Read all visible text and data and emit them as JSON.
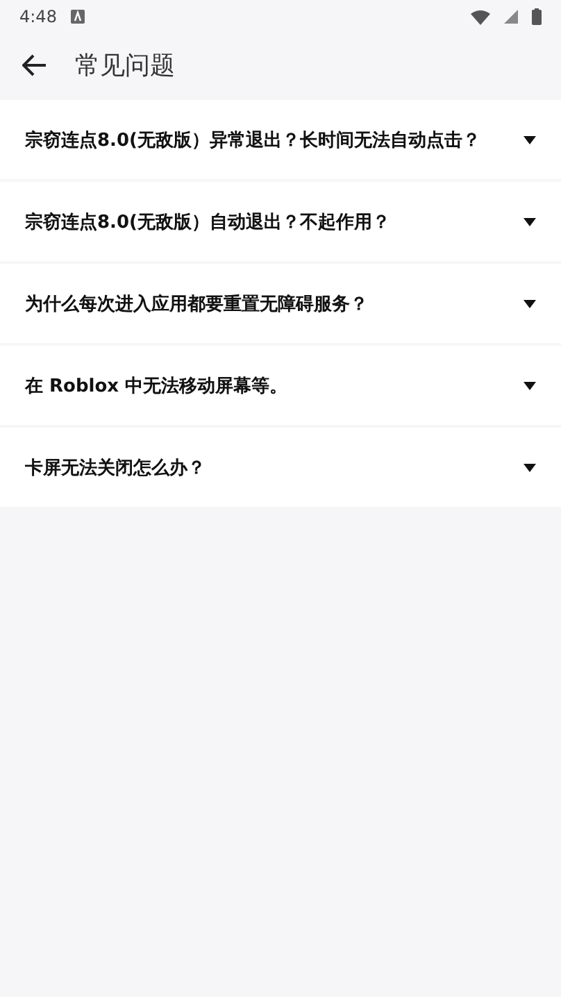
{
  "status_bar": {
    "time": "4:48"
  },
  "app_bar": {
    "title": "常见问题"
  },
  "faq": [
    {
      "question": "宗窃连点8.0(无敌版）异常退出？长时间无法自动点击？",
      "expanded": false
    },
    {
      "question": "宗窃连点8.0(无敌版）自动退出？不起作用？",
      "expanded": false
    },
    {
      "question": "为什么每次进入应用都要重置无障碍服务？",
      "expanded": false
    },
    {
      "question": "在 Roblox 中无法移动屏幕等。",
      "expanded": false
    },
    {
      "question": "卡屏无法关闭怎么办？",
      "expanded": false
    }
  ]
}
